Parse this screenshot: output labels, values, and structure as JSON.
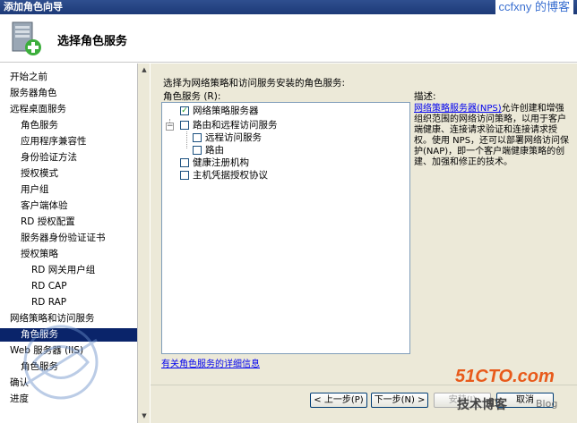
{
  "window": {
    "title": "添加角色向导",
    "watermark": "ccfxny 的博客"
  },
  "header": {
    "title": "选择角色服务"
  },
  "sidebar": {
    "items": [
      {
        "label": "开始之前",
        "level": 0,
        "selected": false
      },
      {
        "label": "服务器角色",
        "level": 0,
        "selected": false
      },
      {
        "label": "远程桌面服务",
        "level": 0,
        "selected": false
      },
      {
        "label": "角色服务",
        "level": 1,
        "selected": false
      },
      {
        "label": "应用程序兼容性",
        "level": 1,
        "selected": false
      },
      {
        "label": "身份验证方法",
        "level": 1,
        "selected": false
      },
      {
        "label": "授权模式",
        "level": 1,
        "selected": false
      },
      {
        "label": "用户组",
        "level": 1,
        "selected": false
      },
      {
        "label": "客户端体验",
        "level": 1,
        "selected": false
      },
      {
        "label": "RD 授权配置",
        "level": 1,
        "selected": false
      },
      {
        "label": "服务器身份验证证书",
        "level": 1,
        "selected": false
      },
      {
        "label": "授权策略",
        "level": 1,
        "selected": false
      },
      {
        "label": "RD 网关用户组",
        "level": 2,
        "selected": false
      },
      {
        "label": "RD CAP",
        "level": 2,
        "selected": false
      },
      {
        "label": "RD RAP",
        "level": 2,
        "selected": false
      },
      {
        "label": "网络策略和访问服务",
        "level": 0,
        "selected": false
      },
      {
        "label": "角色服务",
        "level": 1,
        "selected": true
      },
      {
        "label": "Web 服务器 (IIS)",
        "level": 0,
        "selected": false
      },
      {
        "label": "角色服务",
        "level": 1,
        "selected": false
      },
      {
        "label": "确认",
        "level": 0,
        "selected": false
      },
      {
        "label": "进度",
        "level": 0,
        "selected": false
      }
    ]
  },
  "main": {
    "instruction": "选择为网络策略和访问服务安装的角色服务:",
    "roles_label": "角色服务 (R):",
    "description_label": "描述:",
    "roles": [
      {
        "label": "网络策略服务器",
        "checked": true
      },
      {
        "label": "路由和远程访问服务",
        "checked": false
      },
      {
        "label": "远程访问服务",
        "checked": false
      },
      {
        "label": "路由",
        "checked": false
      },
      {
        "label": "健康注册机构",
        "checked": false
      },
      {
        "label": "主机凭据授权协议",
        "checked": false
      }
    ],
    "description_link": "网络策略服务器(NPS)",
    "description_text": "允许创建和增强组织范围的网络访问策略，以用于客户端健康、连接请求验证和连接请求授权。使用 NPS，还可以部署网络访问保护(NAP)，即一个客户端健康策略的创建、加强和修正的技术。",
    "more_info_link": "有关角色服务的详细信息"
  },
  "buttons": {
    "back": "< 上一步(P)",
    "next": "下一步(N) >",
    "install": "安装(I)",
    "cancel": "取消"
  },
  "watermarks": {
    "site": "51CTO.com",
    "site_cn": "技术博客",
    "blog": "Blog"
  }
}
